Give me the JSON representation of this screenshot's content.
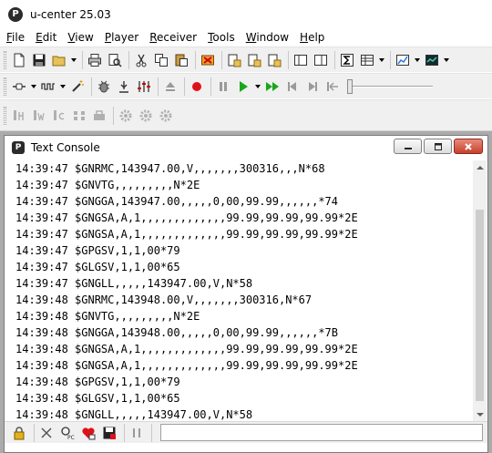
{
  "window": {
    "title": "u-center 25.03",
    "icon_letter": "P"
  },
  "menu": [
    {
      "label": "File",
      "accel": "F",
      "rest": "ile"
    },
    {
      "label": "Edit",
      "accel": "E",
      "rest": "dit"
    },
    {
      "label": "View",
      "accel": "V",
      "rest": "iew"
    },
    {
      "label": "Player",
      "accel": "P",
      "rest": "layer"
    },
    {
      "label": "Receiver",
      "accel": "R",
      "rest": "eceiver"
    },
    {
      "label": "Tools",
      "accel": "T",
      "rest": "ools"
    },
    {
      "label": "Window",
      "accel": "W",
      "rest": "indow"
    },
    {
      "label": "Help",
      "accel": "H",
      "rest": "elp"
    }
  ],
  "console": {
    "title": "Text Console",
    "icon_letter": "P",
    "lines": [
      "14:39:47 $GNRMC,143947.00,V,,,,,,,300316,,,N*68",
      "14:39:47 $GNVTG,,,,,,,,,N*2E",
      "14:39:47 $GNGGA,143947.00,,,,,0,00,99.99,,,,,,*74",
      "14:39:47 $GNGSA,A,1,,,,,,,,,,,,,99.99,99.99,99.99*2E",
      "14:39:47 $GNGSA,A,1,,,,,,,,,,,,,99.99,99.99,99.99*2E",
      "14:39:47 $GPGSV,1,1,00*79",
      "14:39:47 $GLGSV,1,1,00*65",
      "14:39:47 $GNGLL,,,,,143947.00,V,N*58",
      "14:39:48 $GNRMC,143948.00,V,,,,,,,300316,N*67",
      "14:39:48 $GNVTG,,,,,,,,,N*2E",
      "14:39:48 $GNGGA,143948.00,,,,,0,00,99.99,,,,,,*7B",
      "14:39:48 $GNGSA,A,1,,,,,,,,,,,,,99.99,99.99,99.99*2E",
      "14:39:48 $GNGSA,A,1,,,,,,,,,,,,,99.99,99.99,99.99*2E",
      "14:39:48 $GPGSV,1,1,00*79",
      "14:39:48 $GLGSV,1,1,00*65",
      "14:39:48 $GNGLL,,,,,143947.00,V,N*58"
    ]
  },
  "colors": {
    "record": "#e0101a",
    "play": "#18a81c",
    "mdi_background": "#ababab"
  }
}
